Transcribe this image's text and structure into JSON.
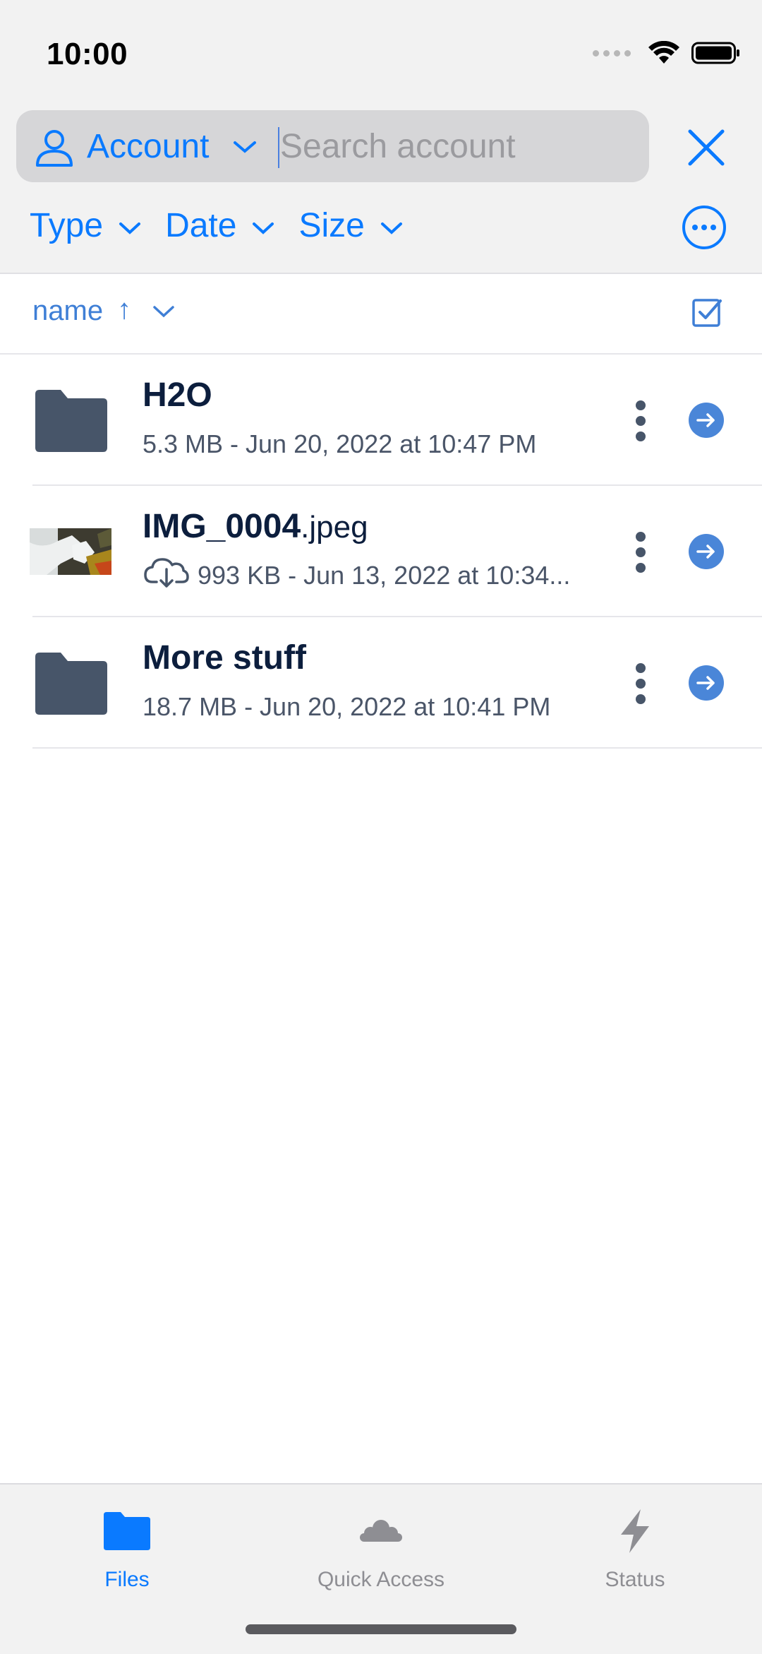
{
  "status_bar": {
    "time": "10:00"
  },
  "search": {
    "account_label": "Account",
    "placeholder": "Search account"
  },
  "filters": [
    {
      "label": "Type"
    },
    {
      "label": "Date"
    },
    {
      "label": "Size"
    }
  ],
  "sort": {
    "label": "name",
    "direction_symbol": "↑"
  },
  "files": [
    {
      "name": "H2O",
      "ext": "",
      "meta": "5.3 MB - Jun 20, 2022 at 10:47 PM",
      "kind": "folder"
    },
    {
      "name": "IMG_0004",
      "ext": ".jpeg",
      "meta": "993 KB - Jun 13, 2022 at 10:34...",
      "kind": "image",
      "status_icon": "cloud-download-icon"
    },
    {
      "name": "More stuff",
      "ext": "",
      "meta": "18.7 MB - Jun 20, 2022 at 10:41 PM",
      "kind": "folder"
    }
  ],
  "tabbar": {
    "tabs": [
      {
        "label": "Files",
        "icon": "folder-icon",
        "active": true
      },
      {
        "label": "Quick Access",
        "icon": "cloud-icon",
        "active": false
      },
      {
        "label": "Status",
        "icon": "bolt-icon",
        "active": false
      }
    ]
  },
  "colors": {
    "accent": "#0a7aff",
    "navy": "#0c1e3d",
    "folder": "#475569",
    "go_button": "#4a86d8",
    "inactive": "#8e8e93"
  }
}
